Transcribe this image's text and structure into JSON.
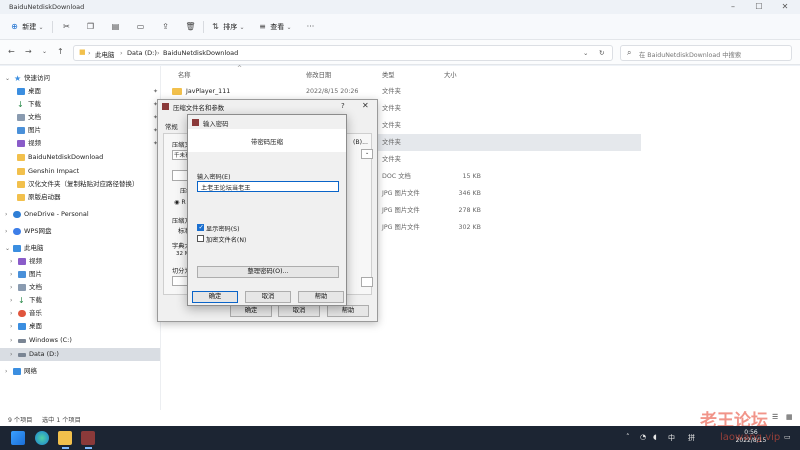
{
  "window": {
    "title": "BaiduNetdiskDownload"
  },
  "toolbar": {
    "new_label": "新建",
    "sort_label": "排序",
    "view_label": "查看"
  },
  "address": {
    "crumbs": [
      "此电脑",
      "Data (D:)",
      "BaiduNetdiskDownload"
    ],
    "search_placeholder": "在 BaiduNetdiskDownload 中搜索"
  },
  "sidebar": {
    "quick_access": "快速访问",
    "quick_items": [
      "桌面",
      "下载",
      "文档",
      "图片",
      "视频",
      "BaiduNetdiskDownload",
      "Genshin Impact",
      "汉化文件夹（复制粘贴对应路径替换）",
      "原版启动器"
    ],
    "onedrive": "OneDrive - Personal",
    "wps": "WPS网盘",
    "this_pc": "此电脑",
    "pc_items": [
      "视频",
      "图片",
      "文档",
      "下载",
      "音乐",
      "桌面",
      "Windows (C:)",
      "Data (D:)"
    ],
    "network": "网络"
  },
  "files": {
    "headers": {
      "name": "名称",
      "date": "修改日期",
      "type": "类型",
      "size": "大小"
    },
    "rows": [
      {
        "name": "JavPlayer_111",
        "date": "2022/8/15 20:26",
        "type": "文件夹",
        "size": ""
      },
      {
        "name": "",
        "date": "",
        "type": "文件夹",
        "size": ""
      },
      {
        "name": "",
        "date": "",
        "type": "文件夹",
        "size": ""
      },
      {
        "name": "",
        "date": "",
        "type": "文件夹",
        "size": ""
      },
      {
        "name": "",
        "date": "",
        "type": "文件夹",
        "size": ""
      },
      {
        "name": "",
        "date": "",
        "type": "DOC 文档",
        "size": "15 KB"
      },
      {
        "name": "",
        "date": "",
        "type": "JPG 图片文件",
        "size": "346 KB"
      },
      {
        "name": "",
        "date": "",
        "type": "JPG 图片文件",
        "size": "278 KB"
      },
      {
        "name": "",
        "date": "",
        "type": "JPG 图片文件",
        "size": "302 KB"
      }
    ]
  },
  "status": {
    "count": "9 个项目",
    "selected": "选中 1 个项目"
  },
  "archive_dialog": {
    "title": "压缩文件名和参数",
    "help_mark": "?",
    "tab": "常规",
    "labels": [
      "压缩文",
      "压缩方",
      "压缩方",
      "字典大",
      "切分为"
    ],
    "values": [
      "千未有",
      "R",
      "标准",
      "32 MB"
    ],
    "browse": "(B)...",
    "ok": "确定",
    "cancel": "取消",
    "help": "帮助"
  },
  "password_dialog": {
    "title": "输入密码",
    "header": "带密码压缩",
    "input_label": "输入密码(E)",
    "password": "上老王论坛当老王",
    "show_password": "显示密码(S)",
    "encrypt_names": "加密文件名(N)",
    "manage": "整理密码(O)...",
    "ok": "确定",
    "cancel": "取消",
    "help": "帮助"
  },
  "taskbar": {
    "ime": "中",
    "ime2": "拼",
    "time": "0:56",
    "date": "2022/8/15"
  },
  "watermark": {
    "brand": "老王论坛",
    "url": "laowang.vip"
  }
}
